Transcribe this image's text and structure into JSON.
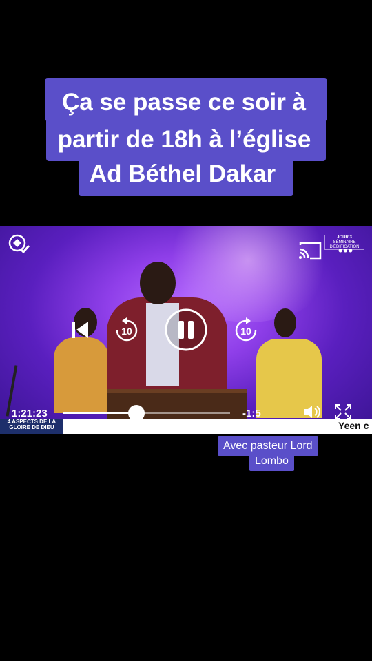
{
  "caption": {
    "line1": "Ça se passe ce soir à",
    "line2": "partir de 18h à l’église",
    "line3": "Ad Béthel Dakar"
  },
  "player": {
    "current_time": "1:21:23",
    "remaining_time": "-1:5",
    "progress": 0.44,
    "badge_top": "JOUR 3",
    "badge_bottom": "SÉMINAIRE D'ÉDIFICATION",
    "banner_title": "4 ASPECTS DE LA GLOIRE DE DIEU",
    "ticker": "Yeen c",
    "icons": [
      "logo-icon",
      "cast-icon",
      "more-icon",
      "previous-icon",
      "rewind-10-icon",
      "pause-icon",
      "forward-10-icon",
      "volume-icon",
      "fullscreen-icon"
    ]
  },
  "subcaption": {
    "line1": "Avec pasteur Lord",
    "line2": "Lombo"
  },
  "colors": {
    "caption_bg": "#5a4fc9",
    "video_purple": "#8f3fe9",
    "banner_blue": "#1d2f6b"
  }
}
